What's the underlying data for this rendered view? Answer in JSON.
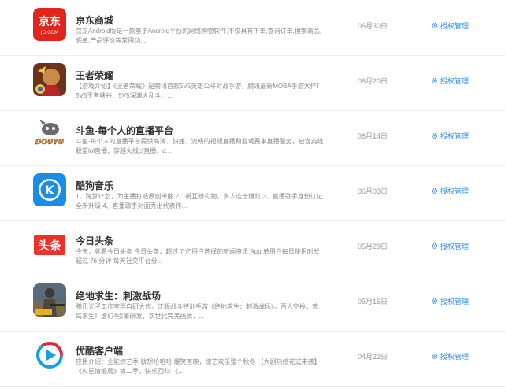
{
  "apps": [
    {
      "name": "京东商城",
      "desc": "京东Android版是一款基于Android平台的网络购物软件,不仅具有下单,查询订单,搜索商品,晒单,产品评价等常用功...",
      "date": "06月30日",
      "action": "授权管理",
      "icon": "jd-logo-icon",
      "logo_text": "京东",
      "logo_sub": "JD.COM"
    },
    {
      "name": "王者荣耀",
      "desc": "【游戏介绍】《王者荣耀》是腾讯首款5V5英雄公平对战手游，腾讯最新MOBA手游大作！5V5王者峡谷、5V5深渊大乱斗、...",
      "date": "06月20日",
      "action": "授权管理",
      "icon": "honor-of-kings-icon"
    },
    {
      "name": "斗鱼-每个人的直播平台",
      "desc": "斗鱼-每个人的直播平台提供高清、快捷、流畅的视频直播和游戏赛事直播服务，包含英雄联盟lol直播、穿越火线cf直播、d...",
      "date": "06月14日",
      "action": "授权管理",
      "icon": "douyu-icon",
      "logo_text": "DOUYU"
    },
    {
      "name": "酷狗音乐",
      "desc": "1、跨梦计划，为主播打造原创单曲 2、新互粉礼物，多人连击爆灯 3、直播歌手身份认证全新升级 4、直播歌手封面秀出代表作...",
      "date": "06月03日",
      "action": "授权管理",
      "icon": "kugou-icon",
      "logo_text": "K"
    },
    {
      "name": "今日头条",
      "desc": "今天，就看今日头条 今日头条，超过 7 亿用户选择的新闻资讯 App 单用户每日使用时长超过 76 分钟 每天社交平台分...",
      "date": "05月29日",
      "action": "授权管理",
      "icon": "toutiao-icon",
      "logo_text": "头条"
    },
    {
      "name": "绝地求生：刺激战场",
      "desc": "腾讯光子工作室群自研大作，正版战斗特训手游《绝地求生：刺激战场》。百人空投，荒岛求生！虚幻4引擎研发，次世代完美画质，...",
      "date": "05月16日",
      "action": "授权管理",
      "icon": "pubg-mobile-icon"
    },
    {
      "name": "优酷客户端",
      "desc": "应用介绍：全能综艺季 就想哈哈哈 爆笑首映，综艺欢乐整个秋冬 【大剧热综花式来袭】《火星情报局》第二季，快乐回归 《...",
      "date": "04月22日",
      "action": "授权管理",
      "icon": "youku-icon"
    }
  ]
}
